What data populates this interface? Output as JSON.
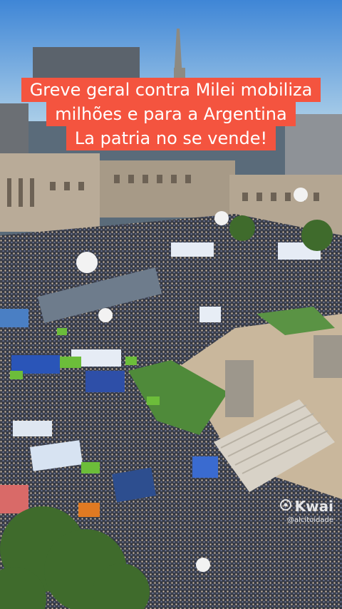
{
  "caption": {
    "lines": [
      "Greve geral contra Milei mobiliza",
      "milhões e para a Argentina",
      "La patria no se vende!"
    ],
    "background_color": "#f4543f",
    "text_color": "#ffffff"
  },
  "watermark": {
    "brand": "Kwai",
    "username": "@alcitoidade"
  },
  "colors": {
    "sky": "#7fb8e6",
    "crowd": "#3b4150",
    "lawn": "#4f8a3a",
    "plaza": "#c9b79c",
    "tree": "#3f6b2c"
  }
}
